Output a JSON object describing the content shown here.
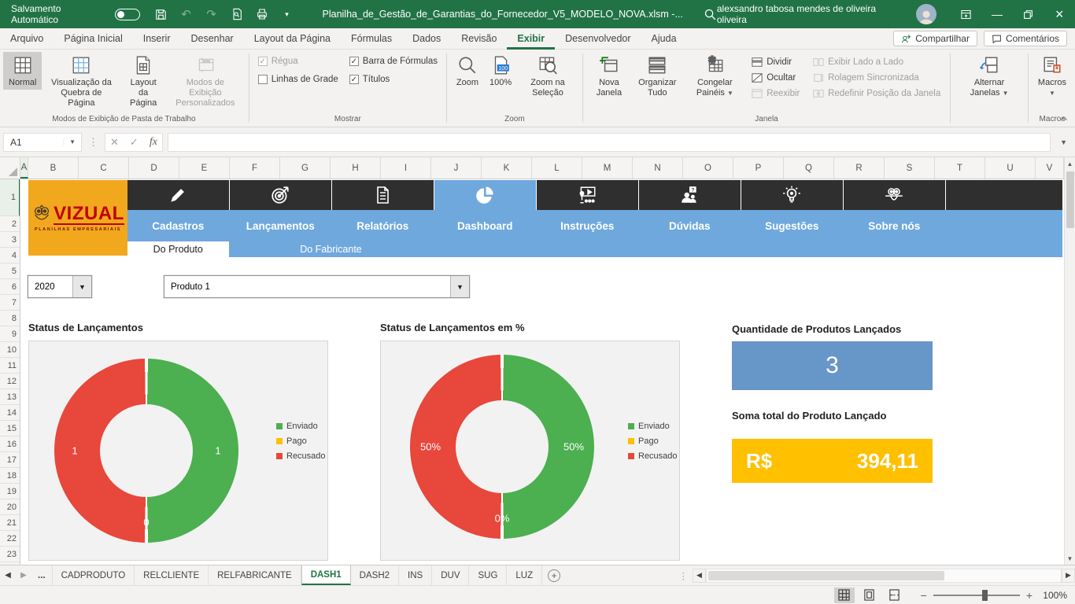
{
  "title_bar": {
    "autosave_label": "Salvamento Automático",
    "autosave_state": "off",
    "filename": "Planilha_de_Gestão_de_Garantias_do_Fornecedor_V5_MODELO_NOVA.xlsm  -...",
    "user_name": "alexsandro tabosa mendes de oliveira oliveira"
  },
  "ribbon": {
    "tabs": [
      "Arquivo",
      "Página Inicial",
      "Inserir",
      "Desenhar",
      "Layout da Página",
      "Fórmulas",
      "Dados",
      "Revisão",
      "Exibir",
      "Desenvolvedor",
      "Ajuda"
    ],
    "active_tab": "Exibir",
    "share_label": "Compartilhar",
    "comments_label": "Comentários",
    "view_group": {
      "label": "Modos de Exibição de Pasta de Trabalho",
      "normal": "Normal",
      "page_break_preview": "Visualização da Quebra de Página",
      "page_layout": "Layout da Página",
      "custom_views": "Modos de Exibição Personalizados"
    },
    "show_group": {
      "label": "Mostrar",
      "ruler": "Régua",
      "gridlines": "Linhas de Grade",
      "formula_bar": "Barra de Fórmulas",
      "headings": "Títulos",
      "states": {
        "ruler": true,
        "gridlines": false,
        "formula_bar": true,
        "headings": true
      }
    },
    "zoom_group": {
      "label": "Zoom",
      "zoom": "Zoom",
      "hundred_percent": "100%",
      "zoom_to_selection": "Zoom na Seleção"
    },
    "window_group": {
      "label": "Janela",
      "new_window": "Nova Janela",
      "arrange_all": "Organizar Tudo",
      "freeze_panes": "Congelar Painéis",
      "split": "Dividir",
      "hide": "Ocultar",
      "unhide": "Reexibir",
      "view_side_by_side": "Exibir Lado a Lado",
      "synchronous_scrolling": "Rolagem Sincronizada",
      "reset_window_position": "Redefinir Posição da Janela"
    },
    "switch_windows_label": "Alternar Janelas",
    "macros_group": {
      "label": "Macros",
      "macros": "Macros"
    }
  },
  "formula_bar": {
    "name_box": "A1",
    "fx_label": "fx",
    "formula": ""
  },
  "grid": {
    "columns": [
      "A",
      "B",
      "C",
      "D",
      "E",
      "F",
      "G",
      "H",
      "I",
      "J",
      "K",
      "L",
      "M",
      "N",
      "O",
      "P",
      "Q",
      "R",
      "S",
      "T",
      "U",
      "V"
    ],
    "rows": [
      1,
      2,
      3,
      4,
      5,
      6,
      7,
      8,
      9,
      10,
      11,
      12,
      13,
      14,
      15,
      16,
      17,
      18,
      19,
      20,
      21,
      22,
      23
    ],
    "selected_cell": "A1"
  },
  "dashboard": {
    "logo": {
      "brand": "VIZUAL",
      "tagline": "PLANILHAS EMPRESARIAIS"
    },
    "nav": {
      "active": "Dashboard",
      "items": [
        {
          "label": "Cadastros",
          "icon": "pencil-icon"
        },
        {
          "label": "Lançamentos",
          "icon": "target-icon"
        },
        {
          "label": "Relatórios",
          "icon": "report-icon"
        },
        {
          "label": "Dashboard",
          "icon": "pie-chart-icon"
        },
        {
          "label": "Instruções",
          "icon": "presenter-icon"
        },
        {
          "label": "Dúvidas",
          "icon": "question-people-icon"
        },
        {
          "label": "Sugestões",
          "icon": "lightbulb-icon"
        },
        {
          "label": "Sobre nós",
          "icon": "owl-icon"
        }
      ]
    },
    "subtabs": {
      "items": [
        "Do Produto",
        "Do Fabricante"
      ],
      "active": "Do Produto"
    },
    "filters": {
      "year": "2020",
      "product": "Produto 1"
    },
    "cards": {
      "qty_title": "Quantidade de Produtos Lançados",
      "qty_value": "3",
      "sum_title": "Soma total do Produto Lançado",
      "sum_currency": "R$",
      "sum_value": "394,11"
    }
  },
  "chart_data": [
    {
      "type": "pie",
      "subtype": "donut",
      "title": "Status de Lançamentos",
      "categories": [
        "Enviado",
        "Pago",
        "Recusado"
      ],
      "values": [
        1,
        0,
        1
      ],
      "labels": [
        "1",
        "0",
        "1"
      ],
      "colors": [
        "#4CAF50",
        "#FFC000",
        "#E8473B"
      ],
      "legend_position": "right"
    },
    {
      "type": "pie",
      "subtype": "donut",
      "title": "Status de Lançamentos em %",
      "categories": [
        "Enviado",
        "Pago",
        "Recusado"
      ],
      "values": [
        50,
        0,
        50
      ],
      "labels": [
        "50%",
        "0%",
        "50%"
      ],
      "colors": [
        "#4CAF50",
        "#FFC000",
        "#E8473B"
      ],
      "legend_position": "right"
    }
  ],
  "sheet_tabs": {
    "tabs": [
      "...",
      "CADPRODUTO",
      "RELCLIENTE",
      "RELFABRICANTE",
      "DASH1",
      "DASH2",
      "INS",
      "DUV",
      "SUG",
      "LUZ"
    ],
    "active": "DASH1"
  },
  "status_bar": {
    "zoom_level": "100%"
  },
  "colors": {
    "title_green": "#217346",
    "nav_blue": "#6FA8DC",
    "dark_bar": "#2F2F2F",
    "logo_orange": "#F2A81D",
    "brand_red": "#C00000",
    "card_blue": "#6796C8",
    "card_yellow": "#FFC000"
  }
}
